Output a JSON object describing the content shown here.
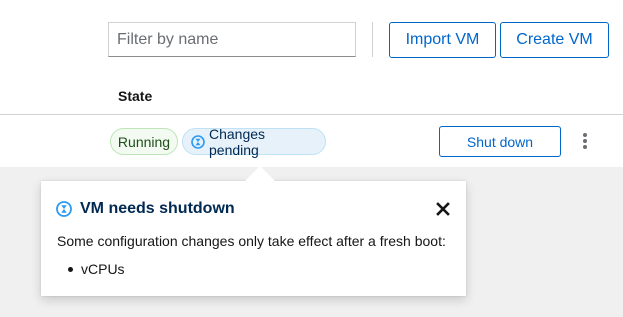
{
  "toolbar": {
    "filter_placeholder": "Filter by name",
    "import_label": "Import VM",
    "create_label": "Create VM"
  },
  "table": {
    "columns": [
      "State"
    ],
    "row": {
      "labels": [
        "Running",
        "Changes pending"
      ],
      "action_label": "Shut down"
    }
  },
  "popover": {
    "title": "VM needs shutdown",
    "body": "Some configuration changes only take effect after a fresh boot:",
    "items": [
      "vCPUs"
    ]
  },
  "colors": {
    "primary": "#0066cc",
    "running_bg": "#f3faf2",
    "pending_bg": "#e7f1fa",
    "pending_icon": "#2b9af3"
  },
  "icons": {
    "pending": "hourglass-icon",
    "close": "close-icon",
    "menu": "kebab-icon"
  }
}
